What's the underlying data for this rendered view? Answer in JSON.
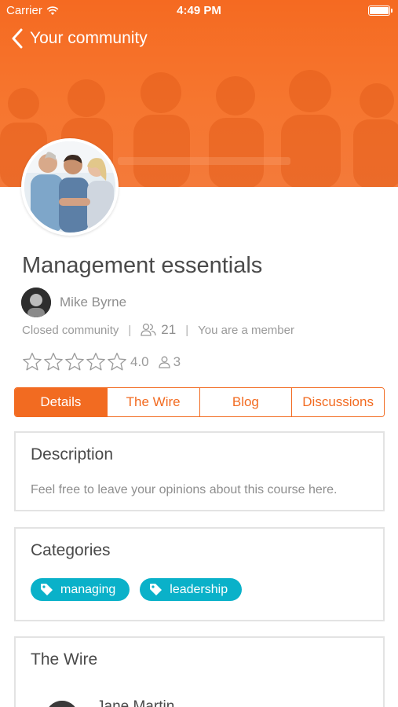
{
  "status_bar": {
    "carrier": "Carrier",
    "time": "4:49 PM"
  },
  "nav": {
    "back_label": "Your community"
  },
  "community": {
    "title": "Management essentials",
    "author": "Mike Byrne",
    "type": "Closed community",
    "member_count": "21",
    "membership": "You are a member",
    "rating": "4.0",
    "rating_count": "3",
    "stars_filled": 0,
    "stars_total": 5
  },
  "tabs": [
    {
      "label": "Details",
      "active": true
    },
    {
      "label": "The Wire",
      "active": false
    },
    {
      "label": "Blog",
      "active": false
    },
    {
      "label": "Discussions",
      "active": false
    }
  ],
  "description": {
    "heading": "Description",
    "text": "Feel free to leave your opinions about this course here."
  },
  "categories": {
    "heading": "Categories",
    "tags": [
      "managing",
      "leadership"
    ]
  },
  "wire": {
    "heading": "The Wire",
    "first_author": "Jane Martin"
  },
  "colors": {
    "brand": "#f26b21",
    "tag": "#0ab1c9",
    "border": "#e3e3e3"
  }
}
